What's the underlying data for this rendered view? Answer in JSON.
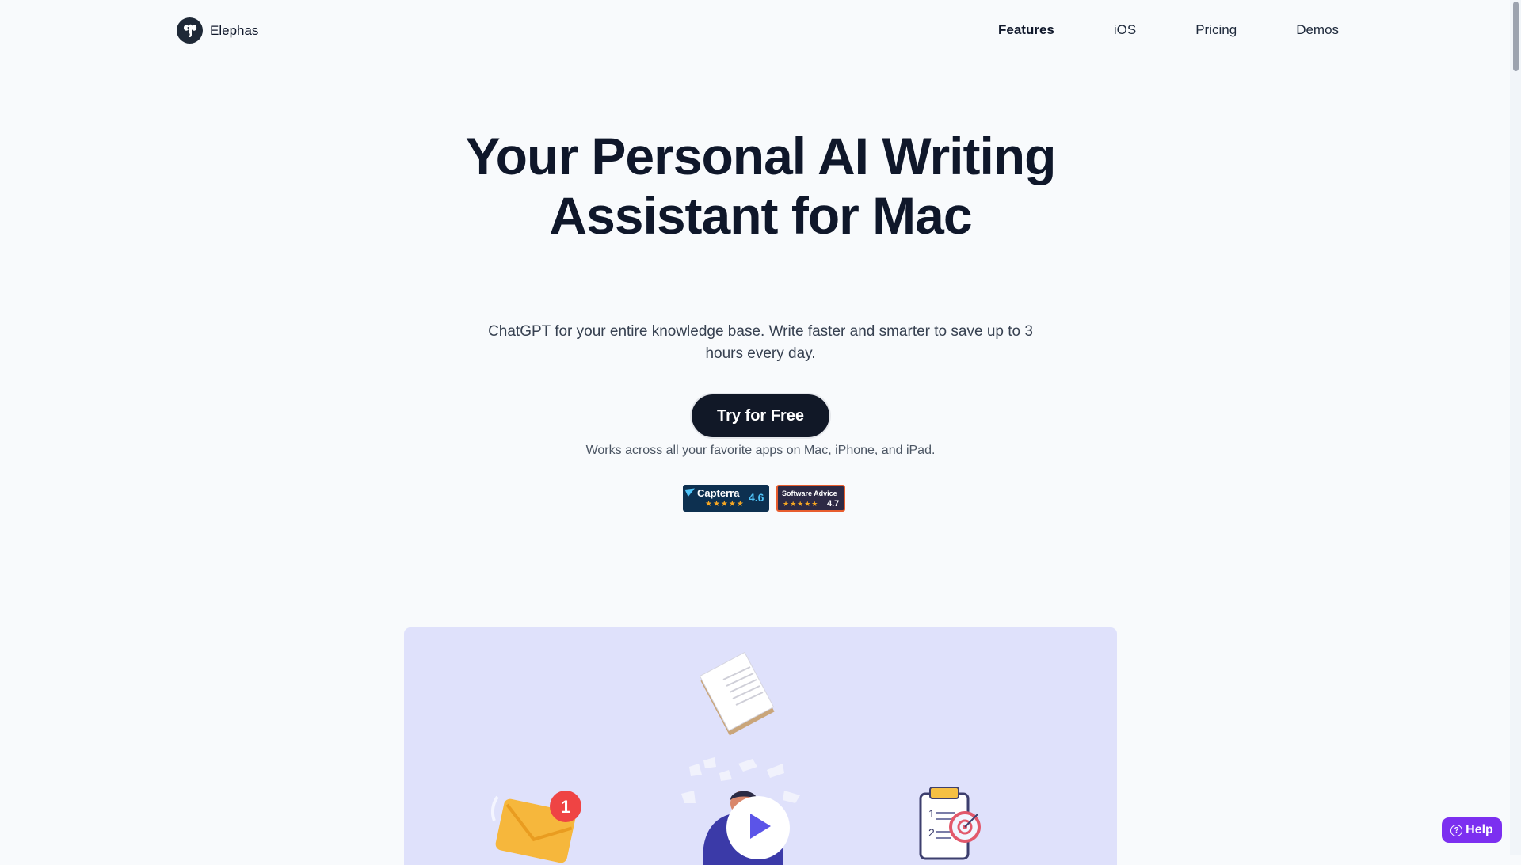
{
  "nav": {
    "brand": "Elephas",
    "links": [
      "Features",
      "iOS",
      "Pricing",
      "Demos"
    ],
    "active": "Features"
  },
  "hero": {
    "title": "Your Personal AI Writing Assistant for Mac",
    "subtitle": "ChatGPT for your entire knowledge base. Write faster and smarter to save up to 3 hours every day.",
    "cta": "Try for Free",
    "note": "Works across all your favorite apps on Mac, iPhone, and iPad."
  },
  "badges": {
    "capterra": {
      "name": "Capterra",
      "stars": "★★★★★",
      "score": "4.6"
    },
    "software_advice": {
      "name": "Software Advice",
      "stars": "★★★★★",
      "score": "4.7"
    }
  },
  "illustration": {
    "notification_count": "1",
    "list_numbers": [
      "1",
      "2"
    ]
  },
  "help": {
    "label": "Help",
    "icon": "?"
  },
  "colors": {
    "background": "#f8fafc",
    "text": "#0f172a",
    "cta": "#111827",
    "panel": "#dfe1fb",
    "play": "#5b54e8",
    "help": "#7c2ff0"
  }
}
